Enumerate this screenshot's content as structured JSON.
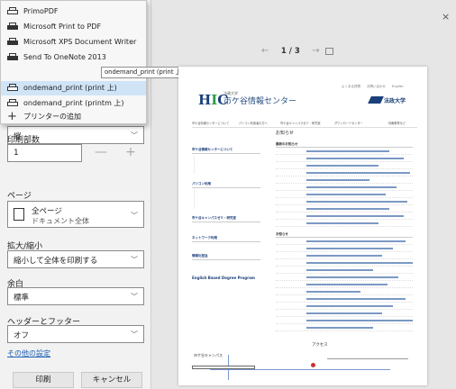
{
  "printer_menu": {
    "items": [
      {
        "label": "PrimoPDF",
        "selected": false
      },
      {
        "label": "Microsoft Print to PDF",
        "selected": false
      },
      {
        "label": "Microsoft XPS Document Writer",
        "selected": false
      },
      {
        "label": "Send To OneNote 2013",
        "selected": false
      },
      {
        "label": "ondemand_print (print 上)",
        "selected": true
      },
      {
        "label": "ondemand_print (printm 上)",
        "selected": false
      },
      {
        "label": "プリンターの追加",
        "selected": false
      }
    ],
    "tooltip": "ondemand_print (print 上)"
  },
  "settings": {
    "orientation_value": "縦",
    "copies_label": "印刷部数",
    "copies_value": "1",
    "pages_label": "ページ",
    "pages_value": "全ページ",
    "pages_sub": "ドキュメント全体",
    "scale_label": "拡大/縮小",
    "scale_value": "縮小して全体を印刷する",
    "margins_label": "余白",
    "margins_value": "標準",
    "header_footer_label": "ヘッダーとフッター",
    "header_footer_value": "オフ",
    "more_settings_link": "その他の設定",
    "print_button": "印刷",
    "cancel_button": "キャンセル"
  },
  "preview": {
    "page_indicator": "1 / 3",
    "prev_arrow": "←",
    "next_arrow": "→",
    "close": "×"
  },
  "page": {
    "header_links": "よくある質問　　お問い合わせ　　English",
    "logo_letters": "HIC",
    "logo_sub": "法政大学",
    "logo_name": "市ケ谷情報センター",
    "university": "法政大学",
    "nav": [
      "市ケ谷情報センターについて",
      "パソコン利用者の方へ",
      "市ケ谷キャンパスゼミ・研究室",
      "ダウンロードセンター",
      "情報教育など"
    ],
    "main_title": "お知らせ",
    "section_news": "最新のお知らせ",
    "section_events": "お知らせ",
    "access": "アクセス",
    "sidebar_heads": [
      "市ケ谷情報センターについて",
      "パソコン利用",
      "市ケ谷キャンパスゼミ・研究室",
      "ネットワーク利用",
      "情報化担当"
    ],
    "ebp": "English Based Degree Program",
    "map_label": "市ケ谷キャンパス"
  }
}
